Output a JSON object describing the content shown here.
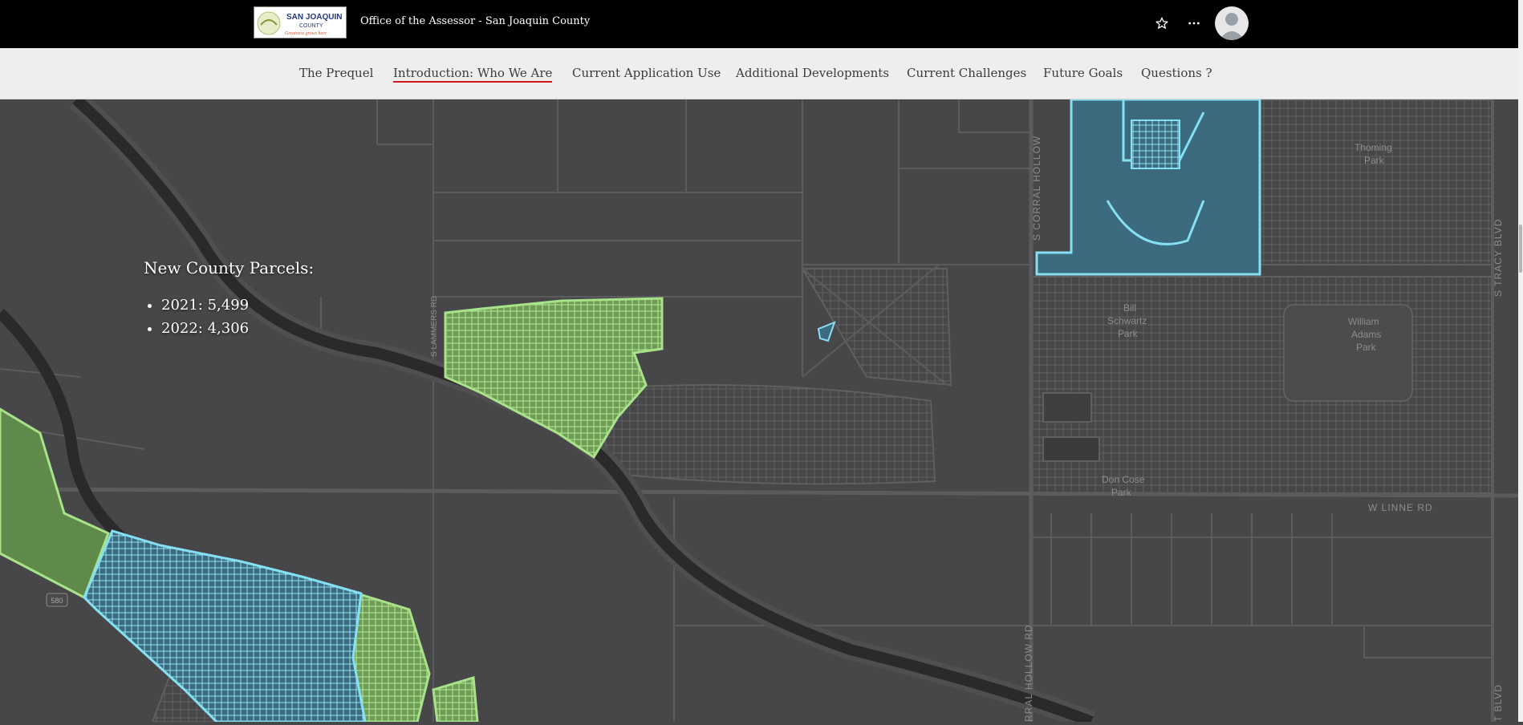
{
  "header": {
    "logo_text_line1": "SAN JOAQUIN",
    "logo_text_line2": "COUNTY",
    "logo_tagline": "Greatness grows here",
    "site_title": "Office of the Assessor - San Joaquin County",
    "favorite_icon": "star-icon",
    "more_icon": "ellipsis-icon",
    "avatar_icon": "user-avatar-icon"
  },
  "nav": {
    "tabs": [
      {
        "label": "The Prequel",
        "active": false
      },
      {
        "label": "Introduction: Who We Are",
        "active": true
      },
      {
        "label": "Current Application Use",
        "active": false
      },
      {
        "label": "Additional Developments",
        "active": false
      },
      {
        "label": "Current Challenges",
        "active": false
      },
      {
        "label": "Future Goals",
        "active": false
      },
      {
        "label": "Questions ?",
        "active": false
      }
    ],
    "active_color": "#d01a1a"
  },
  "overlay": {
    "heading": "New County Parcels:",
    "items": [
      "2021: 5,499",
      "2022: 4,306"
    ]
  },
  "map": {
    "labels": {
      "corral_hollow_top": "S CORRAL HOLLOW",
      "corral_hollow_bottom": "RRAL HOLLOW RD",
      "tracy_blvd_top": "S TRACY BLVD",
      "tracy_blvd_bottom": "T BLVD",
      "lammers": "S LAMMERS RD",
      "linne": "W LINNE RD",
      "thoming_1": "Thoming",
      "thoming_2": "Park",
      "bill_1": "Bill",
      "bill_2": "Schwartz",
      "bill_3": "Park",
      "william_1": "William",
      "william_2": "Adams",
      "william_3": "Park",
      "don_1": "Don Cose",
      "don_2": "Park",
      "highway": "580"
    },
    "colors": {
      "background": "#474749",
      "road": "#5c5c5e",
      "canal": "#2a2a2c",
      "green_fill": "#6f9c56",
      "green_stroke": "#a8e38a",
      "blue_fill": "#3c6a7e",
      "blue_stroke": "#86e0f4"
    }
  }
}
